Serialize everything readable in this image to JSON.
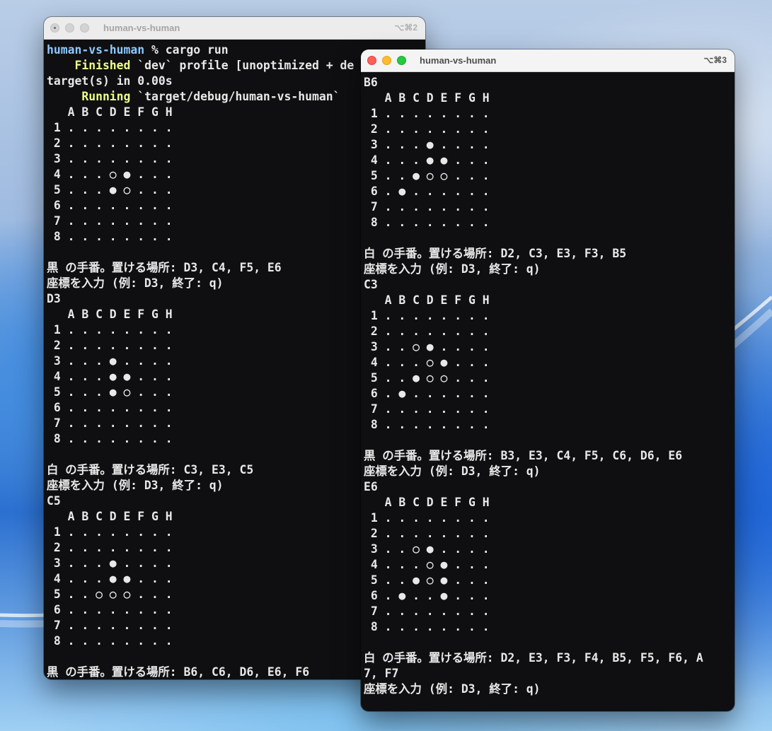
{
  "windows": [
    {
      "title": "human-vs-human",
      "shortcut": "⌥⌘2",
      "lines": [
        {
          "kind": "prompt",
          "prefix": "human-vs-human",
          "text": " % cargo run"
        },
        {
          "kind": "status",
          "prefix": "    Finished",
          "text": " `dev` profile [unoptimized + de"
        },
        {
          "kind": "plain",
          "text": "target(s) in 0.00s"
        },
        {
          "kind": "status",
          "prefix": "     Running",
          "text": " `target/debug/human-vs-human`"
        },
        {
          "kind": "plain",
          "text": "   A B C D E F G H"
        },
        {
          "kind": "plain",
          "text": " 1 . . . . . . . ."
        },
        {
          "kind": "plain",
          "text": " 2 . . . . . . . ."
        },
        {
          "kind": "plain",
          "text": " 3 . . . . . . . ."
        },
        {
          "kind": "plain",
          "text": " 4 . . . ○ ● . . ."
        },
        {
          "kind": "plain",
          "text": " 5 . . . ● ○ . . ."
        },
        {
          "kind": "plain",
          "text": " 6 . . . . . . . ."
        },
        {
          "kind": "plain",
          "text": " 7 . . . . . . . ."
        },
        {
          "kind": "plain",
          "text": " 8 . . . . . . . ."
        },
        {
          "kind": "plain",
          "text": ""
        },
        {
          "kind": "plain",
          "text": "黒 の手番。置ける場所: D3, C4, F5, E6"
        },
        {
          "kind": "plain",
          "text": "座標を入力 (例: D3, 終了: q)"
        },
        {
          "kind": "plain",
          "text": "D3"
        },
        {
          "kind": "plain",
          "text": "   A B C D E F G H"
        },
        {
          "kind": "plain",
          "text": " 1 . . . . . . . ."
        },
        {
          "kind": "plain",
          "text": " 2 . . . . . . . ."
        },
        {
          "kind": "plain",
          "text": " 3 . . . ● . . . ."
        },
        {
          "kind": "plain",
          "text": " 4 . . . ● ● . . ."
        },
        {
          "kind": "plain",
          "text": " 5 . . . ● ○ . . ."
        },
        {
          "kind": "plain",
          "text": " 6 . . . . . . . ."
        },
        {
          "kind": "plain",
          "text": " 7 . . . . . . . ."
        },
        {
          "kind": "plain",
          "text": " 8 . . . . . . . ."
        },
        {
          "kind": "plain",
          "text": ""
        },
        {
          "kind": "plain",
          "text": "白 の手番。置ける場所: C3, E3, C5"
        },
        {
          "kind": "plain",
          "text": "座標を入力 (例: D3, 終了: q)"
        },
        {
          "kind": "plain",
          "text": "C5"
        },
        {
          "kind": "plain",
          "text": "   A B C D E F G H"
        },
        {
          "kind": "plain",
          "text": " 1 . . . . . . . ."
        },
        {
          "kind": "plain",
          "text": " 2 . . . . . . . ."
        },
        {
          "kind": "plain",
          "text": " 3 . . . ● . . . ."
        },
        {
          "kind": "plain",
          "text": " 4 . . . ● ● . . ."
        },
        {
          "kind": "plain",
          "text": " 5 . . ○ ○ ○ . . ."
        },
        {
          "kind": "plain",
          "text": " 6 . . . . . . . ."
        },
        {
          "kind": "plain",
          "text": " 7 . . . . . . . ."
        },
        {
          "kind": "plain",
          "text": " 8 . . . . . . . ."
        },
        {
          "kind": "plain",
          "text": ""
        },
        {
          "kind": "plain",
          "text": "黒 の手番。置ける場所: B6, C6, D6, E6, F6"
        }
      ]
    },
    {
      "title": "human-vs-human",
      "shortcut": "⌥⌘3",
      "lines": [
        {
          "kind": "plain",
          "text": "B6"
        },
        {
          "kind": "plain",
          "text": "   A B C D E F G H"
        },
        {
          "kind": "plain",
          "text": " 1 . . . . . . . ."
        },
        {
          "kind": "plain",
          "text": " 2 . . . . . . . ."
        },
        {
          "kind": "plain",
          "text": " 3 . . . ● . . . ."
        },
        {
          "kind": "plain",
          "text": " 4 . . . ● ● . . ."
        },
        {
          "kind": "plain",
          "text": " 5 . . ● ○ ○ . . ."
        },
        {
          "kind": "plain",
          "text": " 6 . ● . . . . . ."
        },
        {
          "kind": "plain",
          "text": " 7 . . . . . . . ."
        },
        {
          "kind": "plain",
          "text": " 8 . . . . . . . ."
        },
        {
          "kind": "plain",
          "text": ""
        },
        {
          "kind": "plain",
          "text": "白 の手番。置ける場所: D2, C3, E3, F3, B5"
        },
        {
          "kind": "plain",
          "text": "座標を入力 (例: D3, 終了: q)"
        },
        {
          "kind": "plain",
          "text": "C3"
        },
        {
          "kind": "plain",
          "text": "   A B C D E F G H"
        },
        {
          "kind": "plain",
          "text": " 1 . . . . . . . ."
        },
        {
          "kind": "plain",
          "text": " 2 . . . . . . . ."
        },
        {
          "kind": "plain",
          "text": " 3 . . ○ ● . . . ."
        },
        {
          "kind": "plain",
          "text": " 4 . . . ○ ● . . ."
        },
        {
          "kind": "plain",
          "text": " 5 . . ● ○ ○ . . ."
        },
        {
          "kind": "plain",
          "text": " 6 . ● . . . . . ."
        },
        {
          "kind": "plain",
          "text": " 7 . . . . . . . ."
        },
        {
          "kind": "plain",
          "text": " 8 . . . . . . . ."
        },
        {
          "kind": "plain",
          "text": ""
        },
        {
          "kind": "plain",
          "text": "黒 の手番。置ける場所: B3, E3, C4, F5, C6, D6, E6"
        },
        {
          "kind": "plain",
          "text": "座標を入力 (例: D3, 終了: q)"
        },
        {
          "kind": "plain",
          "text": "E6"
        },
        {
          "kind": "plain",
          "text": "   A B C D E F G H"
        },
        {
          "kind": "plain",
          "text": " 1 . . . . . . . ."
        },
        {
          "kind": "plain",
          "text": " 2 . . . . . . . ."
        },
        {
          "kind": "plain",
          "text": " 3 . . ○ ● . . . ."
        },
        {
          "kind": "plain",
          "text": " 4 . . . ○ ● . . ."
        },
        {
          "kind": "plain",
          "text": " 5 . . ● ○ ● . . ."
        },
        {
          "kind": "plain",
          "text": " 6 . ● . . ● . . ."
        },
        {
          "kind": "plain",
          "text": " 7 . . . . . . . ."
        },
        {
          "kind": "plain",
          "text": " 8 . . . . . . . ."
        },
        {
          "kind": "plain",
          "text": ""
        },
        {
          "kind": "plain",
          "text": "白 の手番。置ける場所: D2, E3, F3, F4, B5, F5, F6, A"
        },
        {
          "kind": "plain",
          "text": "7, F7"
        },
        {
          "kind": "plain",
          "text": "座標を入力 (例: D3, 終了: q)"
        }
      ]
    }
  ]
}
